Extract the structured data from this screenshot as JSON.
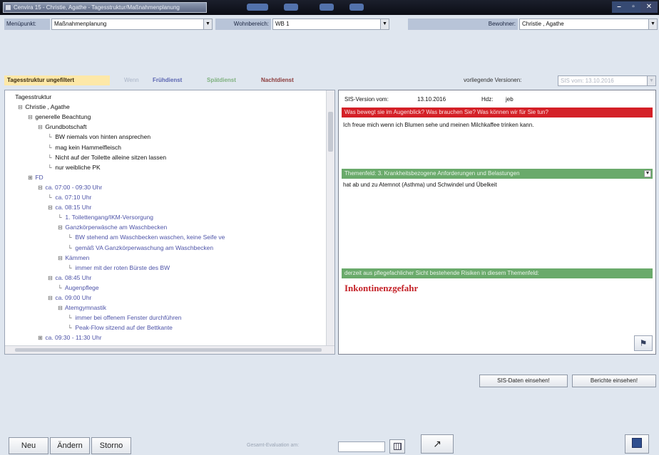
{
  "window": {
    "tab_title": "Cenvira 15 - Christie, Agathe - Tagesstruktur/Maßnahmenplanung",
    "controls": {
      "minimize": "–",
      "maximize": "▫",
      "close": "✕"
    }
  },
  "header": {
    "menupunkt_label": "Menüpunkt:",
    "menupunkt_value": "Maßnahmenplanung",
    "wohnbereich_label": "Wohnbereich:",
    "wohnbereich_value": "WB 1",
    "bewohner_label": "Bewohner:",
    "bewohner_value": "Christie , Agathe"
  },
  "filters": {
    "unfiltered": "Tagesstruktur ungefiltert",
    "wenn": "Wenn",
    "fruehdienst": "Frühdienst",
    "spaetdienst": "Spätdienst",
    "nachtdienst": "Nachtdienst",
    "versions_label": "vorliegende Versionen:",
    "versions_value": "SIS vom: 13.10.2016"
  },
  "tree": {
    "items": [
      {
        "text": "Tagesstruktur",
        "indent": 0,
        "exp": "",
        "purple": false
      },
      {
        "text": "Christie , Agathe",
        "indent": 1,
        "exp": "⊟",
        "purple": false
      },
      {
        "text": "generelle Beachtung",
        "indent": 2,
        "exp": "⊟",
        "purple": false
      },
      {
        "text": "Grundbotschaft",
        "indent": 3,
        "exp": "⊟",
        "purple": false
      },
      {
        "text": "BW niemals von hinten ansprechen",
        "indent": 4,
        "exp": "",
        "purple": false
      },
      {
        "text": "mag kein Hammelfleisch",
        "indent": 4,
        "exp": "",
        "purple": false
      },
      {
        "text": "Nicht auf der Toilette alleine sitzen lassen",
        "indent": 4,
        "exp": "",
        "purple": false
      },
      {
        "text": "nur weibliche PK",
        "indent": 4,
        "exp": "",
        "purple": false
      },
      {
        "text": "FD",
        "indent": 2,
        "exp": "⊞",
        "purple": true
      },
      {
        "text": "ca. 07:00 - 09:30 Uhr",
        "indent": 3,
        "exp": "⊟",
        "purple": true
      },
      {
        "text": "ca. 07:10 Uhr",
        "indent": 4,
        "exp": "",
        "purple": true
      },
      {
        "text": "ca. 08:15 Uhr",
        "indent": 4,
        "exp": "⊟",
        "purple": true
      },
      {
        "text": "1. Toilettengang/IKM-Versorgung",
        "indent": 5,
        "exp": "",
        "purple": true
      },
      {
        "text": "Ganzkörperwäsche am Waschbecken",
        "indent": 5,
        "exp": "⊟",
        "purple": true
      },
      {
        "text": "BW stehend am Waschbecken waschen, keine Seife ve",
        "indent": 6,
        "exp": "",
        "purple": true
      },
      {
        "text": "gemäß VA Ganzkörperwaschung am Waschbecken",
        "indent": 6,
        "exp": "",
        "purple": true
      },
      {
        "text": "Kämmen",
        "indent": 5,
        "exp": "⊟",
        "purple": true
      },
      {
        "text": "immer mit der roten Bürste des BW",
        "indent": 6,
        "exp": "",
        "purple": true
      },
      {
        "text": "ca. 08:45 Uhr",
        "indent": 4,
        "exp": "⊟",
        "purple": true
      },
      {
        "text": "Augenpflege",
        "indent": 5,
        "exp": "",
        "purple": true
      },
      {
        "text": "ca. 09:00 Uhr",
        "indent": 4,
        "exp": "⊟",
        "purple": true
      },
      {
        "text": "Atemgymnastik",
        "indent": 5,
        "exp": "⊟",
        "purple": true
      },
      {
        "text": "immer bei offenem Fenster durchführen",
        "indent": 6,
        "exp": "",
        "purple": true
      },
      {
        "text": "Peak-Flow sitzend auf der Bettkante",
        "indent": 6,
        "exp": "",
        "purple": true
      },
      {
        "text": "ca. 09:30 - 11:30 Uhr",
        "indent": 3,
        "exp": "⊞",
        "purple": true
      }
    ]
  },
  "sis": {
    "version_label": "SIS-Version vom:",
    "version_date": "13.10.2016",
    "hdz_label": "Hdz:",
    "hdz_value": "jeb",
    "question_bar": "Was bewegt sie im Augenblick? Was brauchen Sie? Was können wir für Sie tun?",
    "answer_text": "Ich freue mich wenn ich Blumen sehe und meinen Milchkaffee trinken kann.",
    "themenfeld_bar": "Themenfeld:   3. Krankheitsbezogene Anforderungen und Belastungen",
    "themenfeld_text": "hat ab und zu Atemnot (Asthma) und Schwindel und Übelkeit",
    "risk_bar": "derzeit aus pflegefachlicher Sicht bestehende Risiken in diesem Themenfeld:",
    "risk_text": "Inkontinenzgefahr"
  },
  "actions": {
    "sis_daten": "SIS-Daten einsehen!",
    "berichte": "Berichte einsehen!",
    "neu": "Neu",
    "aendern": "Ändern",
    "storno": "Storno",
    "gesamt_eval_label": "Gesamt-Evaluation am:"
  },
  "colors": {
    "accent_red": "#d42027",
    "accent_green": "#6aaa6b",
    "tree_purple": "#4e54a8"
  }
}
